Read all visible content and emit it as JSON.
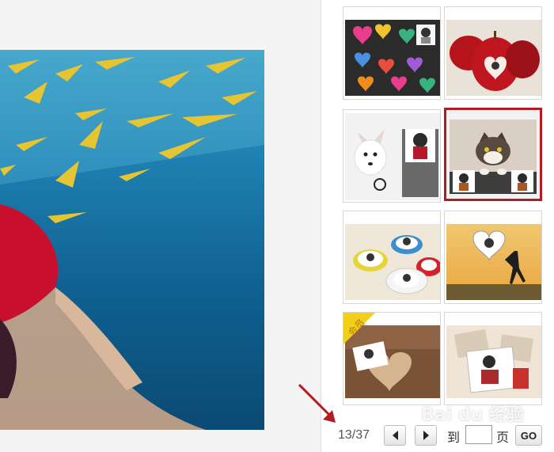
{
  "pager": {
    "page_count": "13/37",
    "current_page": 13,
    "total_pages": 37,
    "goto_prefix": "到",
    "goto_suffix": "页",
    "go_label": "GO",
    "page_input_value": ""
  },
  "thumbnails": [
    {
      "name": "thumb-hearts",
      "selected": false
    },
    {
      "name": "thumb-apple",
      "selected": false
    },
    {
      "name": "thumb-dog",
      "selected": false
    },
    {
      "name": "thumb-cat",
      "selected": true
    },
    {
      "name": "thumb-teacups",
      "selected": false
    },
    {
      "name": "thumb-sunset-heart",
      "selected": false
    },
    {
      "name": "thumb-wooden-heart",
      "selected": false,
      "badge": "会员"
    },
    {
      "name": "thumb-postcards",
      "selected": false
    }
  ],
  "watermark": "Bai du 经验",
  "colors": {
    "selected_border": "#b01e23",
    "annotation_arrow": "#b01e23",
    "page_text": "#555555"
  }
}
